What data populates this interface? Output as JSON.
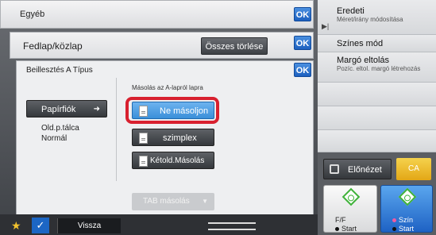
{
  "window": {
    "title": "Egyéb"
  },
  "ok_label": "OK",
  "cover": {
    "label": "Fedlap/közlap",
    "clear_all": "Összes törlése"
  },
  "insertion": {
    "label": "Beillesztés A Típus",
    "section_caption": "Másolás az A-lapról lapra",
    "paper_tray_button": "Papírfiók",
    "tray_line1": "Old.p.tálca",
    "tray_line2": "Normál",
    "options": [
      {
        "label": "Ne másoljon",
        "selected": true
      },
      {
        "label": "szimplex",
        "selected": false
      },
      {
        "label": "Kétold.Másolás",
        "selected": false
      }
    ],
    "tab_copy": "TAB másolás"
  },
  "right_panel": {
    "items": [
      {
        "main": "Eredeti",
        "sub": "Méret/irány módosítása"
      },
      {
        "main": "Színes mód",
        "sub": ""
      },
      {
        "main": "Margó eltolás",
        "sub": "Pozíc. eltol. margó létrehozás"
      }
    ],
    "preview": "Előnézet",
    "clear_all": "CA",
    "start_bw": {
      "line1": "F/F",
      "line2": "Start"
    },
    "start_color": {
      "line1": "Szín",
      "line2": "Start"
    }
  },
  "bottom": {
    "back": "Vissza"
  },
  "colors": {
    "ok_blue": "#1c5fbf",
    "selected_blue": "#3a8fd9",
    "highlight_red": "#d8202f",
    "ca_yellow": "#e3a716",
    "start_green": "#3fb23a"
  }
}
